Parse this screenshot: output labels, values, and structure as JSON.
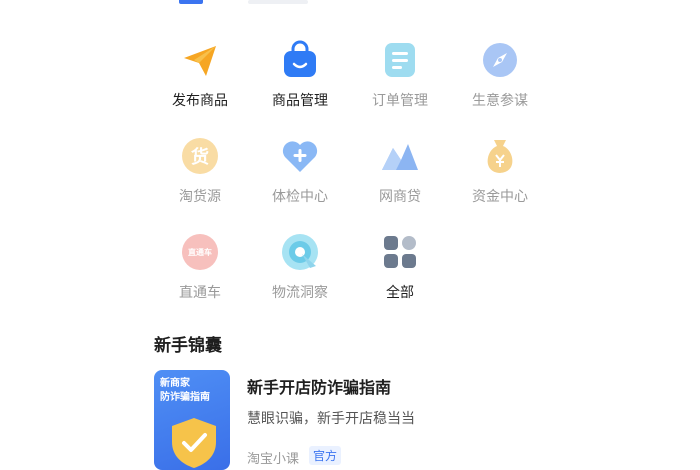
{
  "grid": {
    "items": [
      {
        "label": "发布商品",
        "icon": "paper-plane-icon",
        "style": "dark"
      },
      {
        "label": "商品管理",
        "icon": "shopping-bag-icon",
        "style": "dark"
      },
      {
        "label": "订单管理",
        "icon": "document-list-icon",
        "style": "light"
      },
      {
        "label": "生意参谋",
        "icon": "compass-icon",
        "style": "light"
      },
      {
        "label": "淘货源",
        "icon": "supply-icon",
        "style": "light"
      },
      {
        "label": "体检中心",
        "icon": "heart-plus-icon",
        "style": "light"
      },
      {
        "label": "网商贷",
        "icon": "mountain-icon",
        "style": "light"
      },
      {
        "label": "资金中心",
        "icon": "money-bag-icon",
        "style": "light"
      },
      {
        "label": "直通车",
        "icon": "express-train-icon",
        "style": "light"
      },
      {
        "label": "物流洞察",
        "icon": "logistics-radar-icon",
        "style": "light"
      },
      {
        "label": "全部",
        "icon": "grid-all-icon",
        "style": "dark"
      }
    ]
  },
  "icon_texts": {
    "supply": "货",
    "express": "直通车"
  },
  "section": {
    "title": "新手锦囊"
  },
  "card": {
    "thumb_line1": "新商家",
    "thumb_line2": "防诈骗指南",
    "title": "新手开店防诈骗指南",
    "desc": "慧眼识骗，新手开店稳当当",
    "source": "淘宝小课",
    "badge": "官方"
  },
  "colors": {
    "accent": "#3b74f0",
    "text_dark": "#1f1f1f",
    "text_light": "#9a9a9a"
  }
}
